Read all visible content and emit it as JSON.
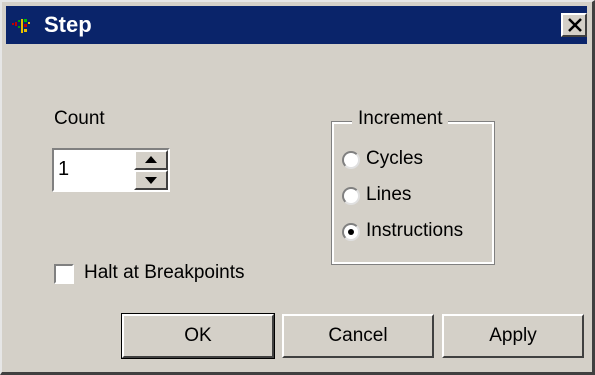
{
  "window": {
    "title": "Step",
    "icon": "step-app-icon",
    "close_icon": "close-icon"
  },
  "count": {
    "label": "Count",
    "value": "1"
  },
  "increment": {
    "label": "Increment",
    "options": [
      {
        "label": "Cycles",
        "selected": false
      },
      {
        "label": "Lines",
        "selected": false
      },
      {
        "label": "Instructions",
        "selected": true
      }
    ]
  },
  "halt": {
    "label": "Halt at Breakpoints",
    "checked": false
  },
  "buttons": {
    "ok": "OK",
    "cancel": "Cancel",
    "apply": "Apply"
  },
  "colors": {
    "titlebar": "#0a246a",
    "dialog_face": "#d4d0c8"
  }
}
